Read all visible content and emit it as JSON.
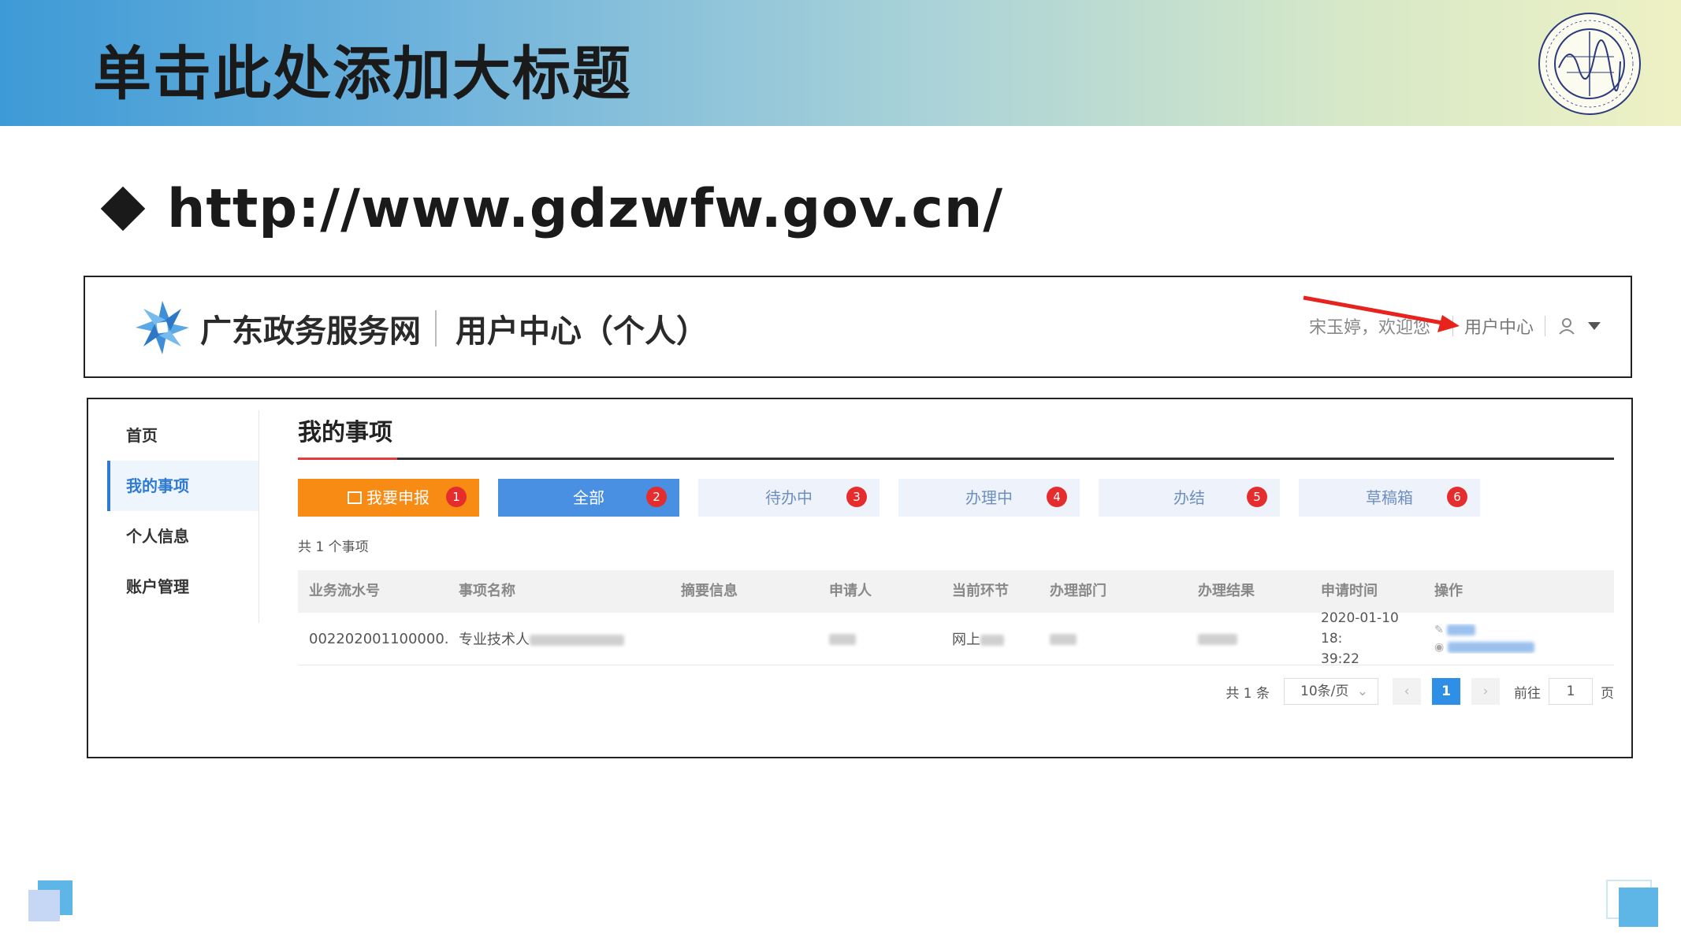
{
  "slide": {
    "title": "单击此处添加大标题",
    "url": "http://www.gdzwfw.gov.cn/"
  },
  "site": {
    "name": "广东政务服务网",
    "subtitle": "用户中心（个人）",
    "welcome": "宋玉婷，欢迎您",
    "user_center": "用户中心"
  },
  "sidebar": {
    "items": [
      {
        "label": "首页"
      },
      {
        "label": "我的事项"
      },
      {
        "label": "个人信息"
      },
      {
        "label": "账户管理"
      }
    ]
  },
  "main": {
    "title": "我的事项",
    "tabs": [
      {
        "label": "我要申报",
        "badge": "1"
      },
      {
        "label": "全部",
        "badge": "2"
      },
      {
        "label": "待办中",
        "badge": "3"
      },
      {
        "label": "办理中",
        "badge": "4"
      },
      {
        "label": "办结",
        "badge": "5"
      },
      {
        "label": "草稿箱",
        "badge": "6"
      }
    ],
    "count_text": "共 1 个事项",
    "table": {
      "headers": [
        "业务流水号",
        "事项名称",
        "摘要信息",
        "申请人",
        "当前环节",
        "办理部门",
        "办理结果",
        "申请时间",
        "操作"
      ],
      "row": {
        "serial": "002202001100000...",
        "item_name_prefix": "专业技术人",
        "current_step_prefix": "网上",
        "time_line1": "2020-01-10 18:",
        "time_line2": "39:22"
      }
    },
    "pager": {
      "total": "共 1 条",
      "page_size": "10条/页",
      "current_page": "1",
      "goto_label": "前往",
      "goto_value": "1",
      "page_suffix": "页"
    }
  },
  "colors": {
    "active_blue": "#2f7bd4",
    "tab_orange": "#f78b13",
    "tab_blue": "#4a90e2",
    "badge_red": "#e52d2d",
    "arrow_red": "#e8231d"
  }
}
